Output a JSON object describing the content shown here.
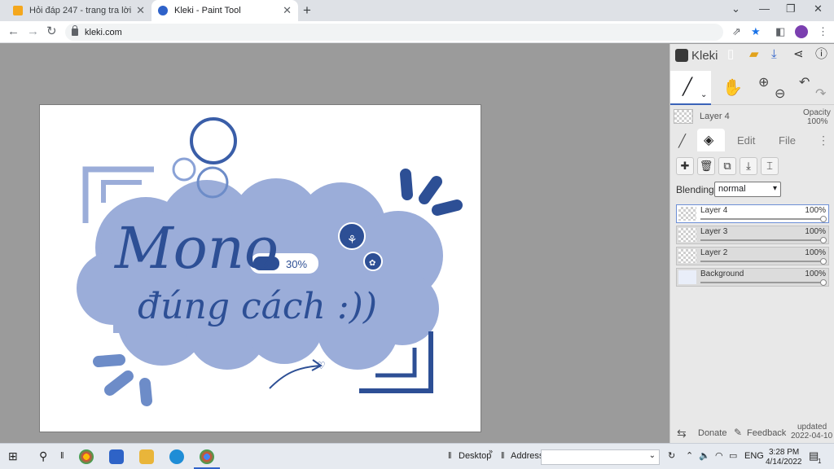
{
  "browser": {
    "tabs": [
      {
        "title": "Hỏi đáp 247 - trang tra lời",
        "active": false,
        "favicon": "hoidap-favicon"
      },
      {
        "title": "Kleki - Paint Tool",
        "active": true,
        "favicon": "kleki-favicon"
      }
    ],
    "url": "kleki.com"
  },
  "artwork": {
    "line1": "Mono",
    "line2": "đúng cách :))",
    "progress_text": "30%",
    "progress_value": 0.3,
    "colors": {
      "cloud": "#9badd9",
      "ink": "#2d4f95",
      "accent": "#3a5ea8"
    }
  },
  "kleki": {
    "brand": "Kleki",
    "current_layer": "Layer 4",
    "opacity_label": "Opacity",
    "opacity_value": "100%",
    "tabs": {
      "edit": "Edit",
      "file": "File"
    },
    "blending_label": "Blending",
    "blending_value": "normal",
    "layers": [
      {
        "name": "Layer 4",
        "opacity": "100%",
        "active": true
      },
      {
        "name": "Layer 3",
        "opacity": "100%",
        "active": false
      },
      {
        "name": "Layer 2",
        "opacity": "100%",
        "active": false
      },
      {
        "name": "Background",
        "opacity": "100%",
        "active": false
      }
    ],
    "footer": {
      "donate": "Donate",
      "feedback": "Feedback",
      "updated_label": "updated",
      "updated_date": "2022-04-10"
    }
  },
  "taskbar": {
    "desktop": "Desktop",
    "address": "Address",
    "lang": "ENG",
    "time": "3:28 PM",
    "date": "4/14/2022",
    "notification_count": "1"
  }
}
